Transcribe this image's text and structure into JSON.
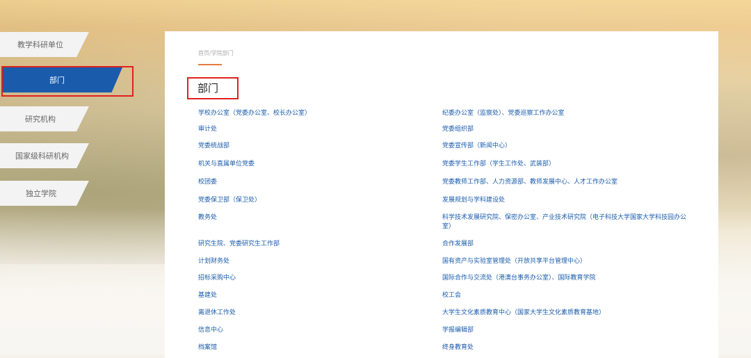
{
  "sidebar": {
    "items": [
      {
        "label": "教学科研单位"
      },
      {
        "label": "部门"
      },
      {
        "label": "研究机构"
      },
      {
        "label": "国家级科研机构"
      },
      {
        "label": "独立学院"
      }
    ]
  },
  "breadcrumb": "首页/学院部门",
  "page_title": "部门",
  "departments_left": [
    "学校办公室（党委办公室、校长办公室）",
    "审计处",
    "党委统战部",
    "机关与直属单位党委",
    "校团委",
    "党委保卫部（保卫处）",
    "教务处",
    "研究生院、党委研究生工作部",
    "计划财务处",
    "招标采购中心",
    "基建处",
    "离退休工作处",
    "信息中心",
    "档案馆"
  ],
  "departments_right": [
    "纪委办公室（监察处）、党委巡察工作办公室",
    "党委组织部",
    "党委宣传部（新闻中心）",
    "党委学生工作部（学生工作处、武装部）",
    "党委教师工作部、人力资源部、教师发展中心、人才工作办公室",
    "发展规划与学科建设处",
    "科学技术发展研究院、保密办公室、产业技术研究院（电子科技大学国家大学科技园办公室）",
    "合作发展部",
    "国有资产与实验室管理处（开放共享平台管理中心）",
    "国际合作与交流处（港澳台事务办公室）、国际教育学院",
    "校工会",
    "大学生文化素质教育中心（国家大学生文化素质教育基地）",
    "学报编辑部",
    "终身教育处"
  ],
  "colors": {
    "accent_blue": "#1a5bab",
    "highlight_red": "#e0201e",
    "breadcrumb_bar": "#e87b3c"
  }
}
